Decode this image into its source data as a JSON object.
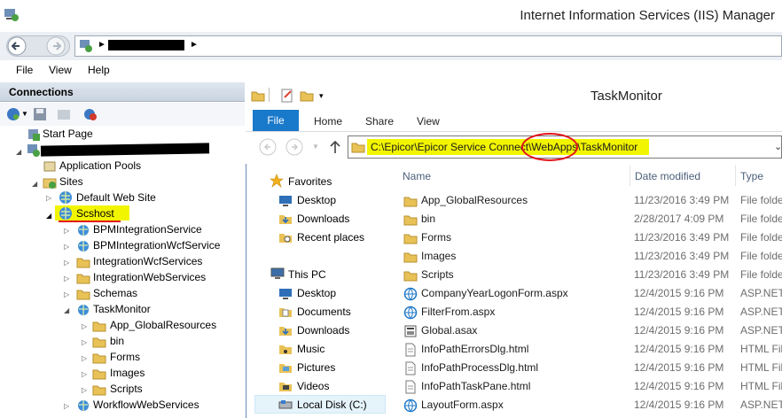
{
  "window": {
    "title": "Internet Information Services (IIS) Manager"
  },
  "menu": {
    "file": "File",
    "view": "View",
    "help": "Help"
  },
  "connections": {
    "header": "Connections",
    "tree": {
      "start_page": "Start Page",
      "app_pools": "Application Pools",
      "sites": "Sites",
      "default_site": "Default Web Site",
      "scshost": "Scshost",
      "children": [
        "BPMIntegrationService",
        "BPMIntegrationWcfService",
        "IntegrationWcfServices",
        "IntegrationWebServices",
        "Schemas",
        "TaskMonitor"
      ],
      "taskmonitor_children": [
        "App_GlobalResources",
        "bin",
        "Forms",
        "Images",
        "Scripts"
      ],
      "last": "WorkflowWebServices"
    }
  },
  "explorer": {
    "title": "TaskMonitor",
    "tabs": {
      "file": "File",
      "home": "Home",
      "share": "Share",
      "view": "View"
    },
    "path": "C:\\Epicor\\Epicor Service Connect\\WebApps\\TaskMonitor",
    "nav": {
      "favorites": "Favorites",
      "fav_items": [
        "Desktop",
        "Downloads",
        "Recent places"
      ],
      "this_pc": "This PC",
      "pc_items": [
        "Desktop",
        "Documents",
        "Downloads",
        "Music",
        "Pictures",
        "Videos",
        "Local Disk (C:)"
      ]
    },
    "columns": {
      "name": "Name",
      "date": "Date modified",
      "type": "Type"
    },
    "files": [
      {
        "name": "App_GlobalResources",
        "date": "11/23/2016 3:49 PM",
        "type": "File folder",
        "icon": "folder"
      },
      {
        "name": "bin",
        "date": "2/28/2017 4:09 PM",
        "type": "File folder",
        "icon": "folder"
      },
      {
        "name": "Forms",
        "date": "11/23/2016 3:49 PM",
        "type": "File folder",
        "icon": "folder"
      },
      {
        "name": "Images",
        "date": "11/23/2016 3:49 PM",
        "type": "File folder",
        "icon": "folder"
      },
      {
        "name": "Scripts",
        "date": "11/23/2016 3:49 PM",
        "type": "File folder",
        "icon": "folder"
      },
      {
        "name": "CompanyYearLogonForm.aspx",
        "date": "12/4/2015 9:16 PM",
        "type": "ASP.NET",
        "icon": "aspx"
      },
      {
        "name": "FilterFrom.aspx",
        "date": "12/4/2015 9:16 PM",
        "type": "ASP.NET",
        "icon": "aspx"
      },
      {
        "name": "Global.asax",
        "date": "12/4/2015 9:16 PM",
        "type": "ASP.NET",
        "icon": "asax"
      },
      {
        "name": "InfoPathErrorsDlg.html",
        "date": "12/4/2015 9:16 PM",
        "type": "HTML File",
        "icon": "html"
      },
      {
        "name": "InfoPathProcessDlg.html",
        "date": "12/4/2015 9:16 PM",
        "type": "HTML File",
        "icon": "html"
      },
      {
        "name": "InfoPathTaskPane.html",
        "date": "12/4/2015 9:16 PM",
        "type": "HTML File",
        "icon": "html"
      },
      {
        "name": "LayoutForm.aspx",
        "date": "12/4/2015 9:16 PM",
        "type": "ASP.NET",
        "icon": "aspx"
      }
    ]
  },
  "colors": {
    "highlight": "#f2f500",
    "annotation": "#e2141b",
    "file_tab": "#1979ca"
  }
}
